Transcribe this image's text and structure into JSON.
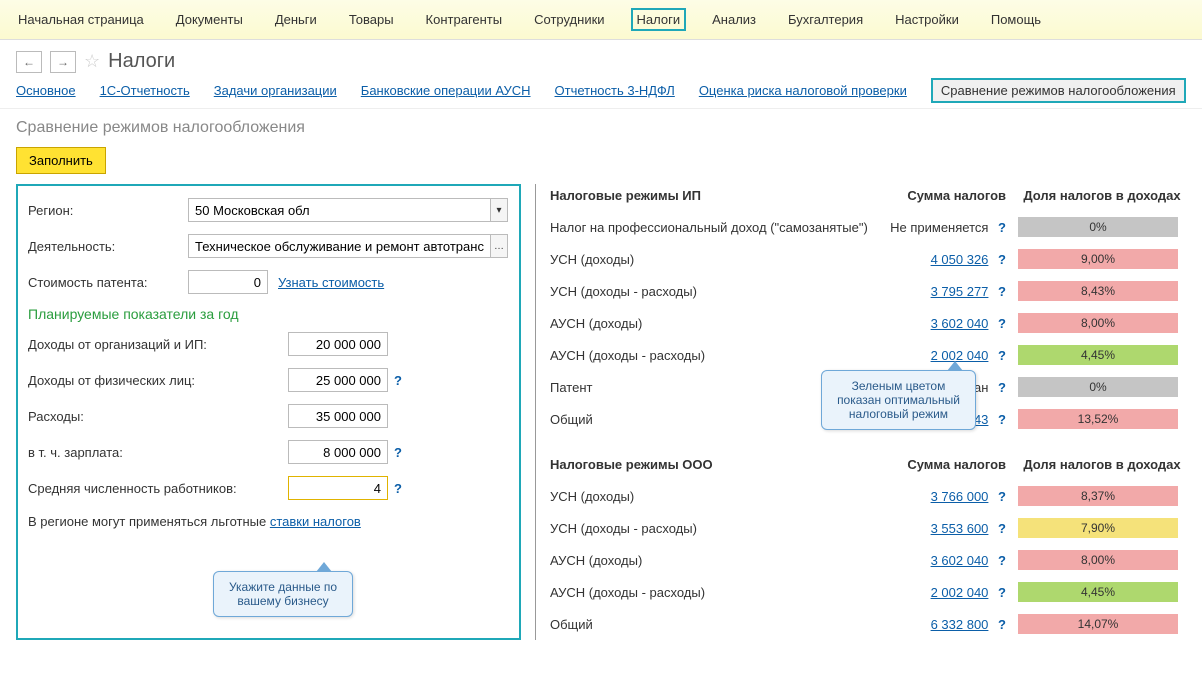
{
  "topmenu": [
    "Начальная страница",
    "Документы",
    "Деньги",
    "Товары",
    "Контрагенты",
    "Сотрудники",
    "Налоги",
    "Анализ",
    "Бухгалтерия",
    "Настройки",
    "Помощь"
  ],
  "topmenu_active": 6,
  "page_title": "Налоги",
  "subtabs": [
    "Основное",
    "1С-Отчетность",
    "Задачи организации",
    "Банковские операции АУСН",
    "Отчетность 3-НДФЛ",
    "Оценка риска налоговой проверки",
    "Сравнение режимов налогообложения"
  ],
  "subtabs_active": 6,
  "view_title": "Сравнение режимов налогообложения",
  "fill_btn": "Заполнить",
  "form": {
    "region_label": "Регион:",
    "region_value": "50 Московская обл",
    "activity_label": "Деятельность:",
    "activity_value": "Техническое обслуживание и ремонт автотранспортн",
    "patent_cost_label": "Стоимость патента:",
    "patent_cost_value": "0",
    "patent_cost_link": "Узнать стоимость",
    "planned_heading": "Планируемые показатели за год",
    "income_org_label": "Доходы от организаций и ИП:",
    "income_org_value": "20 000 000",
    "income_ind_label": "Доходы от физических лиц:",
    "income_ind_value": "25 000 000",
    "expenses_label": "Расходы:",
    "expenses_value": "35 000 000",
    "salary_label": "в т. ч. зарплата:",
    "salary_value": "8 000 000",
    "staff_label": "Средняя численность работников:",
    "staff_value": "4",
    "hint_prefix": "В регионе могут применяться льготные ",
    "hint_link": "ставки налогов"
  },
  "callout_left": "Укажите данные по вашему бизнесу",
  "callout_right": "Зеленым цветом показан оптимальный налоговый режим",
  "right": {
    "head_ip": "Налоговые режимы ИП",
    "head_ooo": "Налоговые режимы ООО",
    "head_sum": "Сумма налогов",
    "head_share": "Доля налогов в доходах",
    "na_text": "Не применяется",
    "nc_text": "Не рассчитан",
    "ip_rows": [
      {
        "name": "Налог на профессиональный доход (\"самозанятые\")",
        "sum": null,
        "sum_text": "na",
        "share": "0%",
        "bar": "bar-gray"
      },
      {
        "name": "УСН (доходы)",
        "sum": "4 050 326",
        "share": "9,00%",
        "bar": "bar-red"
      },
      {
        "name": "УСН (доходы - расходы)",
        "sum": "3 795 277",
        "share": "8,43%",
        "bar": "bar-red"
      },
      {
        "name": "АУСН (доходы)",
        "sum": "3 602 040",
        "share": "8,00%",
        "bar": "bar-red"
      },
      {
        "name": "АУСН (доходы - расходы)",
        "sum": "2 002 040",
        "share": "4,45%",
        "bar": "bar-green"
      },
      {
        "name": "Патент",
        "sum": null,
        "sum_text": "nc",
        "share": "0%",
        "bar": "bar-gray"
      },
      {
        "name": "Общий",
        "sum": "6 086 043",
        "share": "13,52%",
        "bar": "bar-red"
      }
    ],
    "ooo_rows": [
      {
        "name": "УСН (доходы)",
        "sum": "3 766 000",
        "share": "8,37%",
        "bar": "bar-red"
      },
      {
        "name": "УСН (доходы - расходы)",
        "sum": "3 553 600",
        "share": "7,90%",
        "bar": "bar-yellow"
      },
      {
        "name": "АУСН (доходы)",
        "sum": "3 602 040",
        "share": "8,00%",
        "bar": "bar-red"
      },
      {
        "name": "АУСН (доходы - расходы)",
        "sum": "2 002 040",
        "share": "4,45%",
        "bar": "bar-green"
      },
      {
        "name": "Общий",
        "sum": "6 332 800",
        "share": "14,07%",
        "bar": "bar-red"
      }
    ]
  }
}
